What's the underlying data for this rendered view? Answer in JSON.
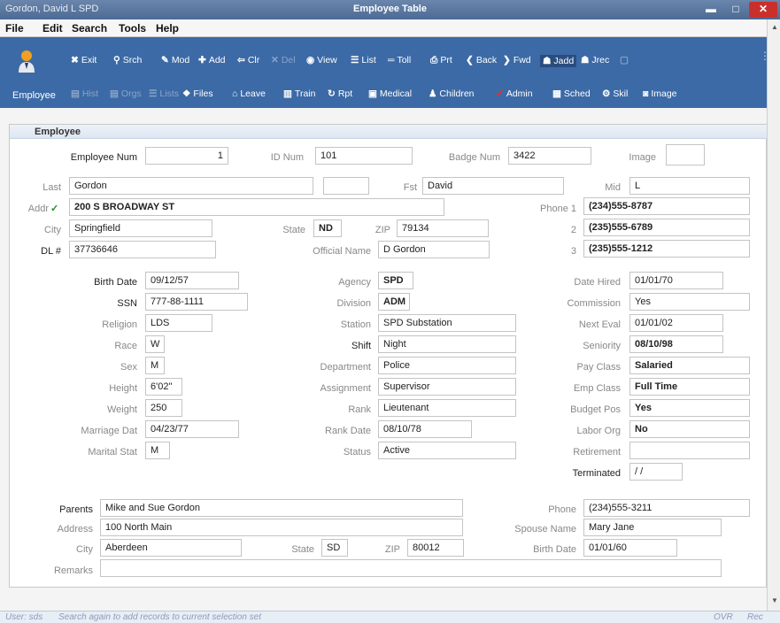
{
  "window": {
    "title": "Gordon, David L SPD",
    "center_title": "Employee Table",
    "min": "▬",
    "max": "□",
    "close": "✕"
  },
  "menu": [
    "File",
    "Edit",
    "Search",
    "Tools",
    "Help"
  ],
  "toolbar": {
    "module_label": "Employee",
    "row1": [
      {
        "icon": "✖",
        "label": "Exit",
        "name": "exit",
        "dim": false,
        "sel": false
      },
      {
        "icon": "⚲",
        "label": "Srch",
        "name": "search",
        "dim": false,
        "sel": false
      },
      {
        "icon": "✎",
        "label": "Mod",
        "name": "modify",
        "dim": false,
        "sel": false
      },
      {
        "icon": "✚",
        "label": "Add",
        "name": "add",
        "dim": false,
        "sel": false
      },
      {
        "icon": "⇦",
        "label": "Clr",
        "name": "clear",
        "dim": false,
        "sel": false
      },
      {
        "icon": "✕",
        "label": "Del",
        "name": "delete",
        "dim": true,
        "sel": false
      },
      {
        "icon": "◉",
        "label": "View",
        "name": "view",
        "dim": false,
        "sel": false
      },
      {
        "icon": "☰",
        "label": "List",
        "name": "list",
        "dim": false,
        "sel": false
      },
      {
        "icon": "═",
        "label": "Toll",
        "name": "toll",
        "dim": false,
        "sel": false
      },
      {
        "icon": "⎙",
        "label": "Prt",
        "name": "print",
        "dim": false,
        "sel": false
      },
      {
        "icon": "❮",
        "label": "Back",
        "name": "back",
        "dim": false,
        "sel": false
      },
      {
        "icon": "❯",
        "label": "Fwd",
        "name": "forward",
        "dim": false,
        "sel": false
      },
      {
        "icon": "☗",
        "label": "Jadd",
        "name": "jadd",
        "dim": false,
        "sel": true
      },
      {
        "icon": "☗",
        "label": "Jrec",
        "name": "jrec",
        "dim": false,
        "sel": false
      },
      {
        "icon": "▢",
        "label": "",
        "name": "extra",
        "dim": true,
        "sel": false
      }
    ],
    "row2": [
      {
        "icon": "▤",
        "label": "Hist",
        "name": "hist",
        "dim": true
      },
      {
        "icon": "▤",
        "label": "Orgs",
        "name": "orgs",
        "dim": true
      },
      {
        "icon": "☰",
        "label": "Lists",
        "name": "lists",
        "dim": true
      },
      {
        "icon": "❖",
        "label": "Files",
        "name": "files",
        "dim": false
      },
      {
        "icon": "⌂",
        "label": "Leave",
        "name": "leave",
        "dim": false
      },
      {
        "icon": "▥",
        "label": "Train",
        "name": "train",
        "dim": false
      },
      {
        "icon": "↻",
        "label": "Rpt",
        "name": "report",
        "dim": false
      },
      {
        "icon": "▣",
        "label": "Medical",
        "name": "medical",
        "dim": false
      },
      {
        "icon": "♟",
        "label": "Children",
        "name": "children",
        "dim": false
      },
      {
        "icon": "✔",
        "label": "Admin",
        "name": "admin",
        "dim": false
      },
      {
        "icon": "▦",
        "label": "Sched",
        "name": "schedule",
        "dim": false
      },
      {
        "icon": "⚙",
        "label": "Skil",
        "name": "skill",
        "dim": false
      },
      {
        "icon": "◙",
        "label": "Image",
        "name": "image",
        "dim": false
      }
    ]
  },
  "colors": {
    "toolbar": "#3c6aa6",
    "admin_check": "#e03030",
    "addr_check": "#2a8a2a"
  },
  "section": {
    "title": "Employee"
  },
  "labels": {
    "emp_num": "Employee Num",
    "id_num": "ID Num",
    "badge_num": "Badge Num",
    "image": "Image",
    "last": "Last",
    "first": "Fst",
    "mid": "Mid",
    "addr": "Addr",
    "phone1": "Phone 1",
    "city": "City",
    "state": "State",
    "zip": "ZIP",
    "phone2": "2",
    "dl": "DL #",
    "official_name": "Official Name",
    "phone3": "3",
    "birth_date": "Birth Date",
    "ssn": "SSN",
    "religion": "Religion",
    "race": "Race",
    "sex": "Sex",
    "height": "Height",
    "weight": "Weight",
    "marriage_dat": "Marriage Dat",
    "marital_stat": "Marital Stat",
    "agency": "Agency",
    "division": "Division",
    "station": "Station",
    "shift": "Shift",
    "department": "Department",
    "assignment": "Assignment",
    "rank": "Rank",
    "rank_date": "Rank Date",
    "status": "Status",
    "date_hired": "Date Hired",
    "commission": "Commission",
    "next_eval": "Next Eval",
    "seniority": "Seniority",
    "pay_class": "Pay Class",
    "emp_class": "Emp Class",
    "budget_pos": "Budget Pos",
    "labor_org": "Labor Org",
    "retirement": "Retirement",
    "terminated": "Terminated",
    "parents": "Parents",
    "p_address": "Address",
    "p_city": "City",
    "p_state": "State",
    "p_zip": "ZIP",
    "p_phone": "Phone",
    "spouse_name": "Spouse Name",
    "spouse_birth": "Birth Date",
    "remarks": "Remarks"
  },
  "values": {
    "emp_num": "1",
    "id_num": "101",
    "badge_num": "3422",
    "image": "",
    "last": "Gordon",
    "last_suffix": "",
    "first": "David",
    "mid": "L",
    "addr_check": "✓",
    "addr": "200 S BROADWAY ST",
    "phone1": "(234)555-8787",
    "city": "Springfield",
    "state": "ND",
    "zip": "79134",
    "phone2": "(235)555-6789",
    "dl": "37736646",
    "official_name": "D Gordon",
    "phone3": "(235)555-1212",
    "birth_date": "09/12/57",
    "ssn": "777-88-1111",
    "religion": "LDS",
    "race": "W",
    "sex": "M",
    "height": "6'02\"",
    "weight": "250",
    "marriage_dat": "04/23/77",
    "marital_stat": "M",
    "agency": "SPD",
    "division": "ADM",
    "station": "SPD Substation",
    "shift": "Night",
    "department": "Police",
    "assignment": "Supervisor",
    "rank": "Lieutenant",
    "rank_date": "08/10/78",
    "status": "Active",
    "date_hired": "01/01/70",
    "commission": "Yes",
    "next_eval": "01/01/02",
    "seniority": "08/10/98",
    "pay_class": "Salaried",
    "emp_class": "Full Time",
    "budget_pos": "Yes",
    "labor_org": "No",
    "retirement": "",
    "terminated": " / /",
    "parents": "Mike and Sue Gordon",
    "p_address": "100 North Main",
    "p_city": "Aberdeen",
    "p_state": "SD",
    "p_zip": "80012",
    "p_phone": "(234)555-3211",
    "spouse_name": "Mary Jane",
    "spouse_birth": "01/01/60",
    "remarks": ""
  },
  "status": {
    "user": "User: sds",
    "message": "Search again to add records to current selection set",
    "ovr": "OVR",
    "rec": "Rec"
  }
}
